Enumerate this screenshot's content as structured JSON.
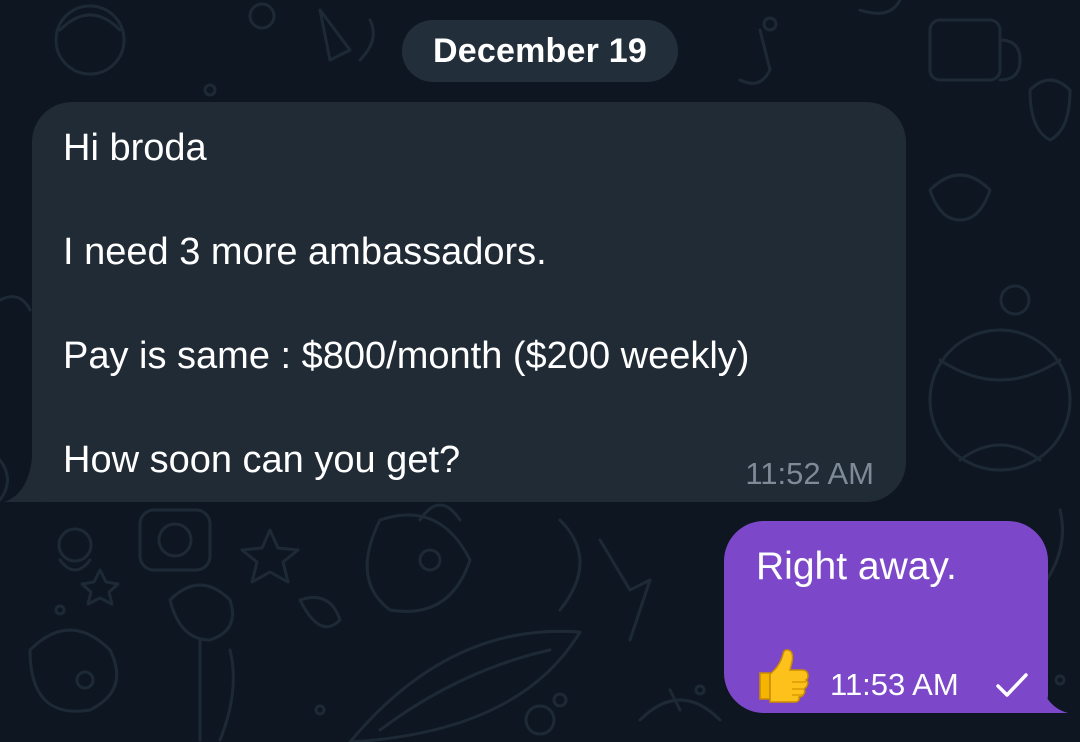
{
  "date_separator": "December 19",
  "incoming_message": {
    "text": "Hi broda\n\nI need 3 more ambassadors.\n\nPay is same : $800/month ($200 weekly)\n\nHow soon can you get?",
    "time": "11:52 AM"
  },
  "outgoing_message": {
    "text": "Right away.",
    "reaction_icon": "thumbs-up-emoji",
    "time": "11:53 AM",
    "status_icon": "single-check-icon"
  },
  "colors": {
    "background": "#0e1621",
    "incoming_bubble": "#202b36",
    "outgoing_bubble": "#7c48c9",
    "timestamp_incoming": "#7e8a97",
    "date_pill": "#26323e"
  }
}
